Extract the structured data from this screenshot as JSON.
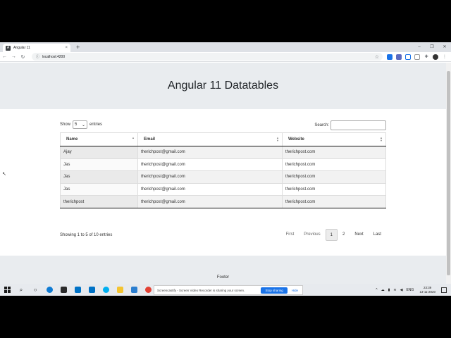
{
  "browser": {
    "tab_title": "Angular 11",
    "tab_close": "×",
    "new_tab": "+",
    "url": "localhost:4200",
    "window_controls": [
      "–",
      "❐",
      "✕"
    ]
  },
  "page": {
    "heading": "Angular 11 Datatables",
    "length": {
      "show": "Show",
      "value": "5",
      "entries": "entries"
    },
    "search_label": "Search:",
    "columns": [
      "Name",
      "Email",
      "Website"
    ],
    "rows": [
      [
        "Ajay",
        "therichpost@gmail.com",
        "therichpost.com"
      ],
      [
        "Jas",
        "therichpost@gmail.com",
        "therichpost.com"
      ],
      [
        "Jas",
        "therichpost@gmail.com",
        "therichpost.com"
      ],
      [
        "Jas",
        "therichpost@gmail.com",
        "therichpost.com"
      ],
      [
        "therichpost",
        "therichpost@gmail.com",
        "therichpost.com"
      ]
    ],
    "info": "Showing 1 to 5 of 10 entries",
    "pagination": {
      "first": "First",
      "previous": "Previous",
      "page1": "1",
      "page2": "2",
      "next": "Next",
      "last": "Last"
    },
    "footer": "Footer"
  },
  "taskbar": {
    "share_message": "Screencastify - Screen Video Recorder is sharing your screen.",
    "stop_sharing": "Stop sharing",
    "hide": "Hide",
    "language": "ENG",
    "time": "23:39",
    "date": "13-11-2020",
    "icon_colors": {
      "edge": "#0f7bd3",
      "store": "#2b2b2b",
      "mail": "#0072c6",
      "skype": "#00aff0",
      "explorer": "#f4c430",
      "vscode": "#2c7fd0",
      "chrome": "#e34133"
    }
  }
}
